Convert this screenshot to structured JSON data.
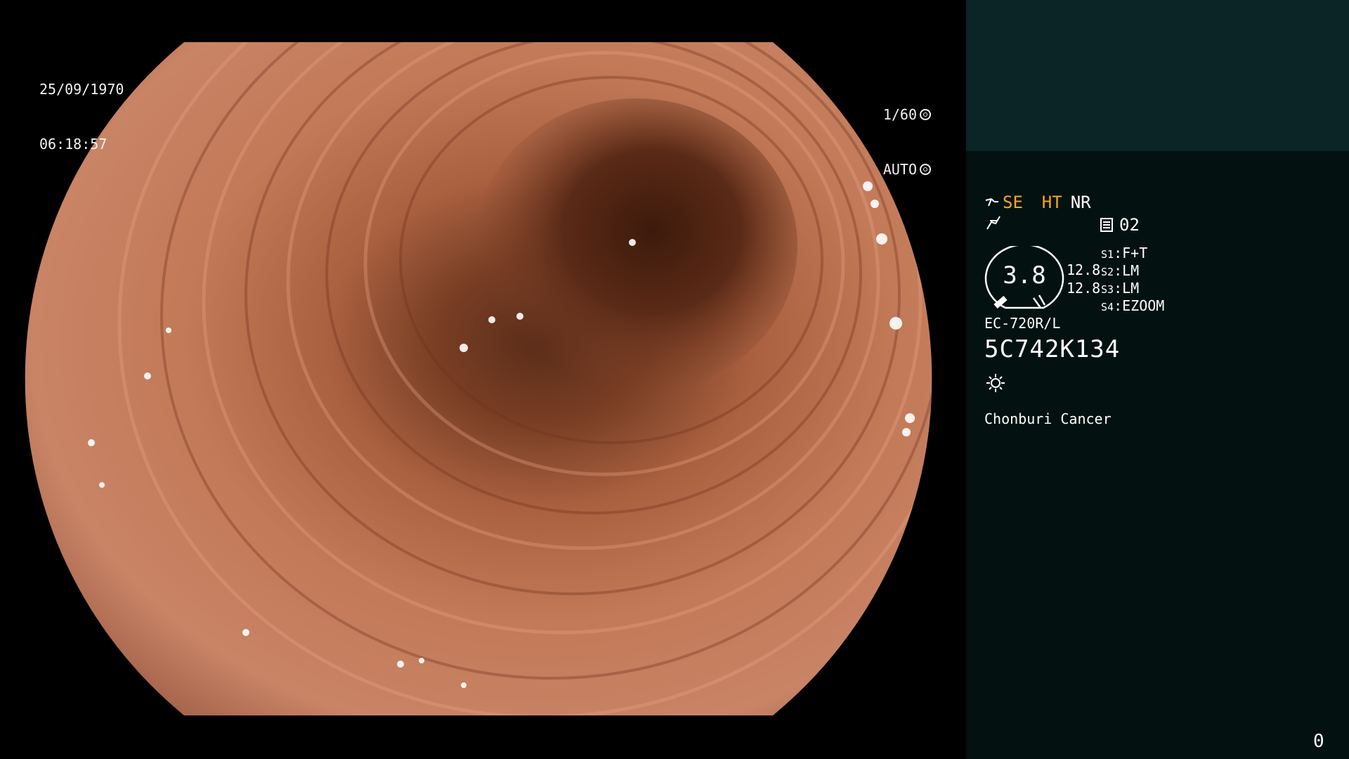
{
  "overlay": {
    "date": "25/09/1970",
    "time": "06:18:57",
    "shutter_speed": "1/60",
    "exposure_mode": "AUTO"
  },
  "info_panel": {
    "mode_ht": "HT",
    "mode_nr": "NR",
    "structure_enhance": "SE",
    "memory_number": "02",
    "gauge_value": "3.8",
    "level_1": "12.8",
    "level_2": "12.8",
    "switches": [
      {
        "key": "S1",
        "value": "F+T"
      },
      {
        "key": "S2",
        "value": "LM"
      },
      {
        "key": "S3",
        "value": "LM"
      },
      {
        "key": "S4",
        "value": "EZOOM"
      }
    ],
    "scope_model": "EC-720R/L",
    "scope_serial": "5C742K134",
    "institution": "Chonburi Cancer",
    "corner_counter": "0"
  },
  "icons": {
    "shutter": "shutter-icon",
    "exposure": "exposure-icon",
    "structure": "structure-enhance-icon",
    "wave": "color-enhance-icon",
    "memory": "memory-icon",
    "light": "light-source-icon"
  },
  "colors": {
    "accent_orange": "#f2a623",
    "panel_bg": "#031210",
    "panel_top_bg": "#0b2425"
  }
}
